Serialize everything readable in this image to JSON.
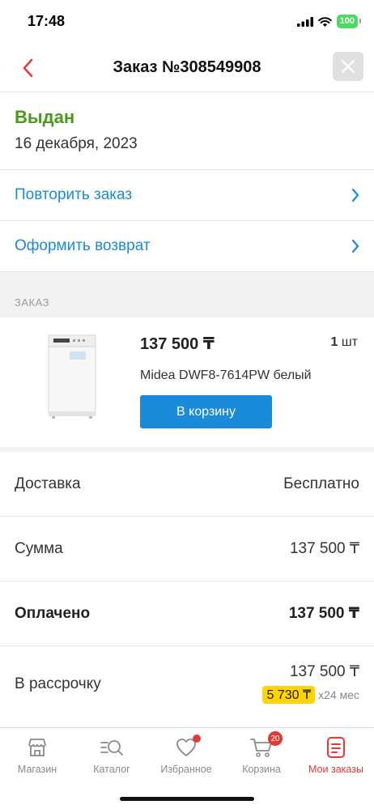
{
  "status_bar": {
    "time": "17:48",
    "battery": "100"
  },
  "nav": {
    "title": "Заказ №308549908",
    "back_icon": "chevron-left-icon",
    "close_icon": "close-icon"
  },
  "order": {
    "status": "Выдан",
    "date": "16 декабря, 2023"
  },
  "actions": [
    {
      "label": "Повторить заказ"
    },
    {
      "label": "Оформить возврат"
    }
  ],
  "section_order": "ЗАКАЗ",
  "product": {
    "price": "137 500 ₸",
    "qty_number": "1",
    "qty_unit": " шт",
    "name": "Midea DWF8-7614PW белый",
    "cart_button": "В корзину"
  },
  "summary": {
    "delivery_label": "Доставка",
    "delivery_value": "Бесплатно",
    "sum_label": "Сумма",
    "sum_value": "137 500 ₸",
    "paid_label": "Оплачено",
    "paid_value": "137 500 ₸",
    "installment_label": "В рассрочку",
    "installment_total": "137 500 ₸",
    "installment_monthly": "5 730 ₸",
    "installment_term": "x24 мес"
  },
  "tabs": [
    {
      "label": "Магазин",
      "icon": "store-icon"
    },
    {
      "label": "Каталог",
      "icon": "catalog-search-icon"
    },
    {
      "label": "Избранное",
      "icon": "heart-icon"
    },
    {
      "label": "Корзина",
      "icon": "cart-icon",
      "badge": "20"
    },
    {
      "label": "Мои заказы",
      "icon": "orders-icon",
      "active": true
    }
  ],
  "colors": {
    "accent_blue": "#1a8bd8",
    "status_green": "#4a9a1c",
    "brand_red": "#e53935",
    "installment_yellow": "#ffd400"
  }
}
